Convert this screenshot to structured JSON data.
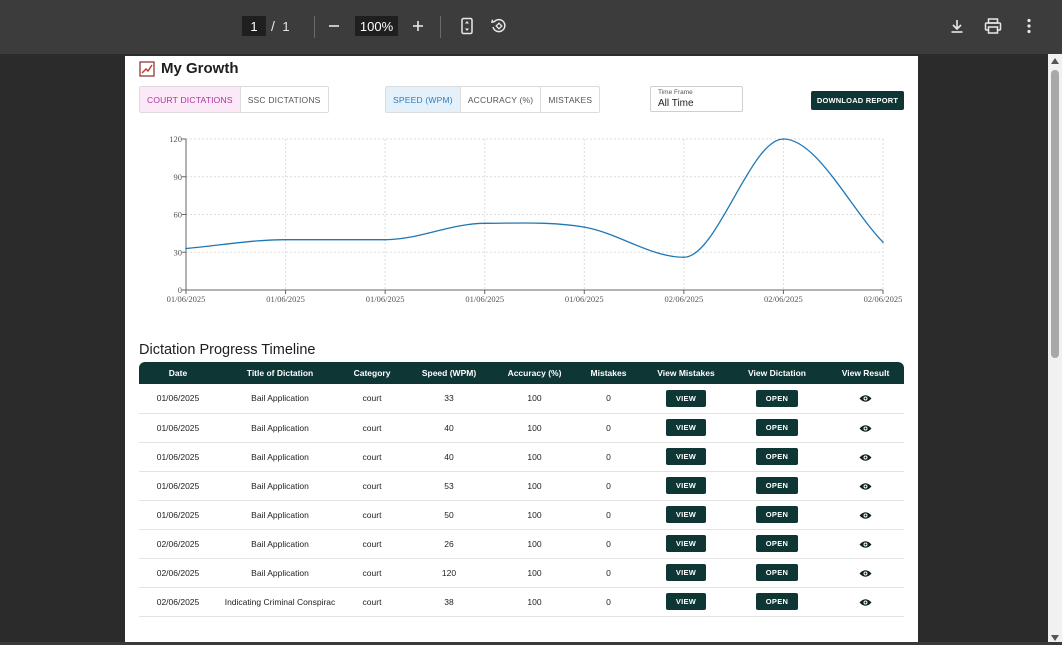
{
  "toolbar": {
    "current_page": "1",
    "separator": "/",
    "total_pages": "1",
    "zoom": "100%",
    "icons": [
      "minus-icon",
      "plus-icon",
      "fit-page-icon",
      "rotate-icon",
      "download-icon",
      "print-icon",
      "more-vert-icon"
    ]
  },
  "report": {
    "title": "My Growth",
    "category_tabs": [
      "COURT DICTATIONS",
      "SSC DICTATIONS"
    ],
    "active_category": "COURT DICTATIONS",
    "metric_tabs": [
      "SPEED (WPM)",
      "ACCURACY (%)",
      "MISTAKES"
    ],
    "active_metric": "SPEED (WPM)",
    "timeframe": {
      "label": "Time Frame",
      "value": "All Time"
    },
    "download_label": "DOWNLOAD REPORT"
  },
  "chart_data": {
    "type": "line",
    "x": [
      "01/06/2025",
      "01/06/2025",
      "01/06/2025",
      "01/06/2025",
      "01/06/2025",
      "02/06/2025",
      "02/06/2025",
      "02/06/2025"
    ],
    "series": [
      {
        "values": [
          33,
          40,
          40,
          53,
          50,
          26,
          120,
          38
        ]
      }
    ],
    "yticks": [
      0,
      30,
      60,
      90,
      120
    ],
    "ylim": [
      0,
      120
    ],
    "grid": true,
    "line_color": "#1f77b4"
  },
  "timeline": {
    "title": "Dictation Progress Timeline",
    "columns": [
      "Date",
      "Title of Dictation",
      "Category",
      "Speed (WPM)",
      "Accuracy (%)",
      "Mistakes",
      "View Mistakes",
      "View Dictation",
      "View Result"
    ],
    "view_label": "VIEW",
    "open_label": "OPEN",
    "rows": [
      {
        "date": "01/06/2025",
        "title": "Bail Application",
        "category": "court",
        "speed": "33",
        "accuracy": "100",
        "mistakes": "0"
      },
      {
        "date": "01/06/2025",
        "title": "Bail Application",
        "category": "court",
        "speed": "40",
        "accuracy": "100",
        "mistakes": "0"
      },
      {
        "date": "01/06/2025",
        "title": "Bail Application",
        "category": "court",
        "speed": "40",
        "accuracy": "100",
        "mistakes": "0"
      },
      {
        "date": "01/06/2025",
        "title": "Bail Application",
        "category": "court",
        "speed": "53",
        "accuracy": "100",
        "mistakes": "0"
      },
      {
        "date": "01/06/2025",
        "title": "Bail Application",
        "category": "court",
        "speed": "50",
        "accuracy": "100",
        "mistakes": "0"
      },
      {
        "date": "02/06/2025",
        "title": "Bail Application",
        "category": "court",
        "speed": "26",
        "accuracy": "100",
        "mistakes": "0"
      },
      {
        "date": "02/06/2025",
        "title": "Bail Application",
        "category": "court",
        "speed": "120",
        "accuracy": "100",
        "mistakes": "0"
      },
      {
        "date": "02/06/2025",
        "title": "Indicating Criminal Conspirac",
        "category": "court",
        "speed": "38",
        "accuracy": "100",
        "mistakes": "0"
      }
    ]
  }
}
